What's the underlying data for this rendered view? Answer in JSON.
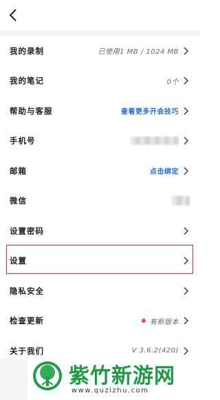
{
  "header": {
    "back_icon": "chevron-left-icon"
  },
  "items": [
    {
      "label": "我的录制",
      "value": "已使用1 MB / 1024 MB",
      "type": "text"
    },
    {
      "label": "我的笔记",
      "value": "0个",
      "type": "text"
    },
    {
      "label": "帮助与客服",
      "value": "查看更多开会技巧",
      "type": "link"
    },
    {
      "label": "手机号",
      "value": "",
      "type": "blurred"
    },
    {
      "label": "邮箱",
      "value": "点击绑定",
      "type": "link"
    },
    {
      "label": "微信",
      "value": "",
      "type": "blurred-short"
    },
    {
      "label": "设置密码",
      "value": "",
      "type": "none"
    },
    {
      "label": "设置",
      "value": "",
      "type": "none"
    },
    {
      "label": "隐私安全",
      "value": "",
      "type": "none"
    },
    {
      "label": "检查更新",
      "value": "有新版本",
      "type": "update"
    },
    {
      "label": "关于我们",
      "value": "V 3.6.2(420)",
      "type": "text"
    }
  ],
  "watermark": {
    "title": "紫竹新游网",
    "url": "www.quzizhu.com"
  },
  "colors": {
    "accent": "#1f6fd6",
    "highlight": "#e02727",
    "dot": "#e8503c",
    "brand": "#1e9b43"
  }
}
